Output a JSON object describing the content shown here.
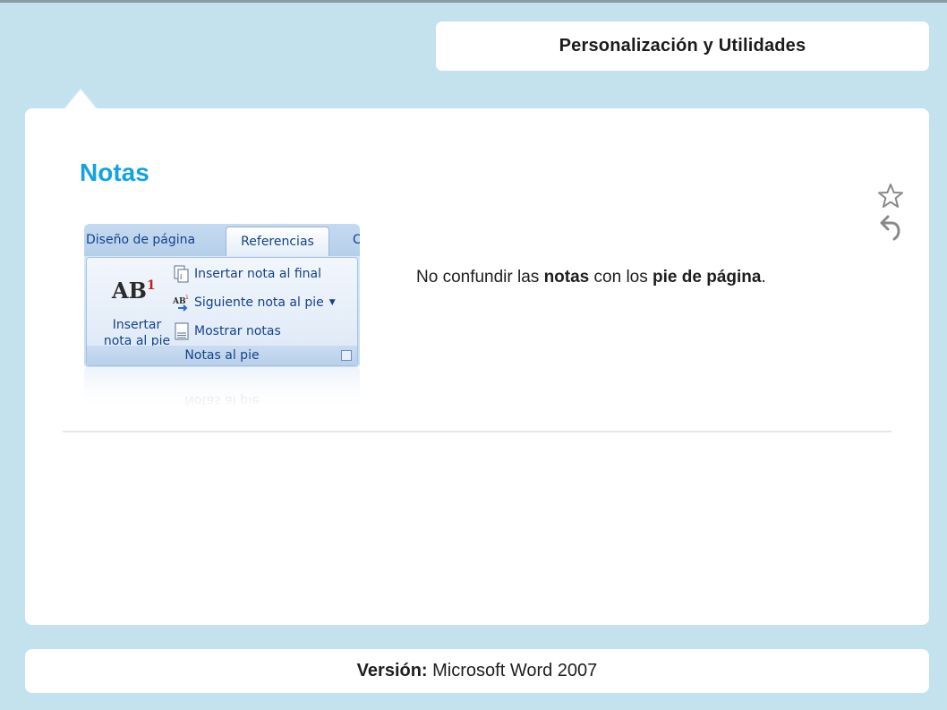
{
  "header": {
    "title": "Personalización y Utilidades"
  },
  "content": {
    "title": "Notas",
    "description": {
      "part1": "No confundir las ",
      "bold1": "notas",
      "part2": " con los ",
      "bold2": "pie de página",
      "part3": "."
    }
  },
  "ribbon": {
    "tabs": [
      "Diseño de página",
      "Referencias",
      "C"
    ],
    "big_button": {
      "label_line1": "Insertar",
      "label_line2": "nota al pie",
      "icon_text": "AB",
      "icon_sup": "1"
    },
    "items": [
      "Insertar nota al final",
      "Siguiente nota al pie",
      "Mostrar notas"
    ],
    "group_label": "Notas al pie"
  },
  "icons": {
    "favorite": "star-icon",
    "back": "back-arrow-icon"
  },
  "footer": {
    "version_label": "Versión:",
    "version_value": " Microsoft Word 2007"
  },
  "colors": {
    "background": "#c4e2ee",
    "title": "#12a3e0",
    "card": "#ffffff"
  }
}
